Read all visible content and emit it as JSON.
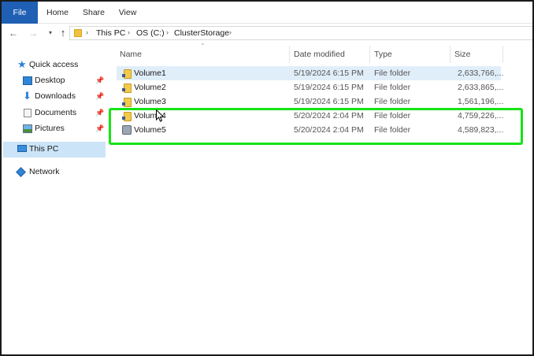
{
  "ribbon": {
    "tabs": [
      {
        "label": "File"
      },
      {
        "label": "Home"
      },
      {
        "label": "Share"
      },
      {
        "label": "View"
      }
    ]
  },
  "address": {
    "crumbs": [
      "This PC",
      "OS (C:)",
      "ClusterStorage"
    ],
    "separator": "›"
  },
  "navpane": {
    "items": [
      {
        "label": "Quick access",
        "icon": "star-icon"
      },
      {
        "label": "Desktop",
        "icon": "desktop-icon",
        "pinned": true
      },
      {
        "label": "Downloads",
        "icon": "download-icon",
        "pinned": true
      },
      {
        "label": "Documents",
        "icon": "documents-icon",
        "pinned": true
      },
      {
        "label": "Pictures",
        "icon": "pictures-icon",
        "pinned": true
      },
      {
        "label": "This PC",
        "icon": "computer-icon",
        "selected": true
      },
      {
        "label": "Network",
        "icon": "network-icon"
      }
    ]
  },
  "columns": {
    "name": "Name",
    "date": "Date modified",
    "type": "Type",
    "size": "Size"
  },
  "files": [
    {
      "name": "Volume1",
      "date": "5/19/2024 6:15 PM",
      "type": "File folder",
      "size": "2,633,766,...",
      "selected": true
    },
    {
      "name": "Volume2",
      "date": "5/19/2024 6:15 PM",
      "type": "File folder",
      "size": "2,633,865,..."
    },
    {
      "name": "Volume3",
      "date": "5/19/2024 6:15 PM",
      "type": "File folder",
      "size": "1,561,196,..."
    },
    {
      "name": "Volume4",
      "date": "5/20/2024 2:04 PM",
      "type": "File folder",
      "size": "4,759,226,..."
    },
    {
      "name": "Volume5",
      "date": "5/20/2024 2:04 PM",
      "type": "File folder",
      "size": "4,589,823,..."
    }
  ],
  "colors": {
    "file_tab": "#1f5fb4",
    "selection": "#cce4f7",
    "highlight": "#16e316"
  }
}
